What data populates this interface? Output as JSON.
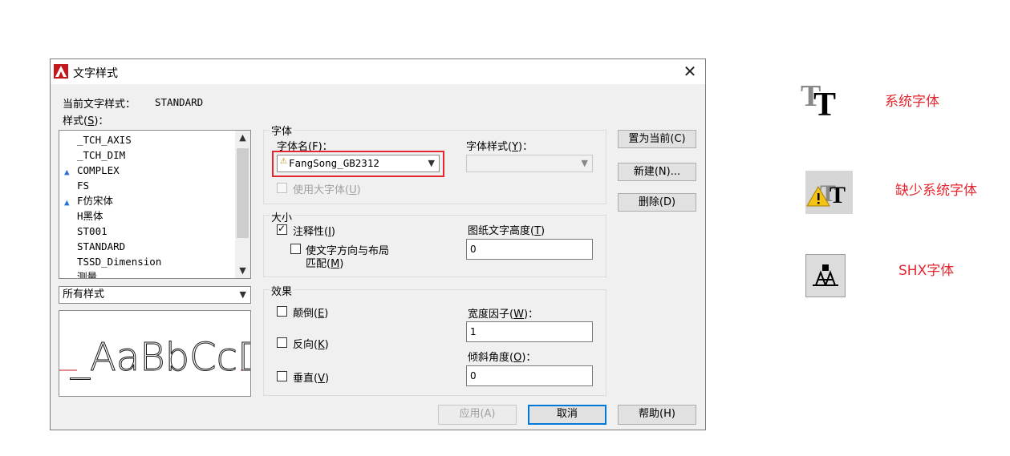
{
  "dialog": {
    "title": "文字样式",
    "current_style_label": "当前文字样式：",
    "current_style_value": "STANDARD",
    "styles_label": "样式(",
    "styles_key": "S",
    "styles_label_end": ")：",
    "styles": [
      "_TCH_AXIS",
      "_TCH_DIM",
      "COMPLEX",
      "FS",
      "F仿宋体",
      "H黑体",
      "ST001",
      "STANDARD",
      "TSSD_Dimension",
      "测量"
    ],
    "filter_value": "所有样式",
    "preview_text": "_AaBbCcD",
    "font_group": {
      "title": "字体",
      "font_name_label": "字体名(",
      "font_name_key": "F",
      "font_name_end": ")：",
      "font_name_value": "FangSong_GB2312",
      "font_style_label": "字体样式(",
      "font_style_key": "Y",
      "font_style_end": ")：",
      "font_style_value": "",
      "bigfont_label": "使用大字体(",
      "bigfont_key": "U",
      "bigfont_end": ")"
    },
    "size_group": {
      "title": "大小",
      "annotative_label": "注释性(",
      "annotative_key": "I",
      "annotative_end": ")",
      "annotative_checked": true,
      "match_label_1": "使文字方向与布局",
      "match_label_2": "匹配(",
      "match_key": "M",
      "match_end": ")",
      "match_checked": false,
      "paper_height_label": "图纸文字高度(",
      "paper_height_key": "T",
      "paper_height_end": ")",
      "paper_height_value": "0"
    },
    "effects_group": {
      "title": "效果",
      "upside_down_label": "颠倒(",
      "upside_down_key": "E",
      "upside_down_end": ")",
      "backwards_label": "反向(",
      "backwards_key": "K",
      "backwards_end": ")",
      "vertical_label": "垂直(",
      "vertical_key": "V",
      "vertical_end": ")",
      "width_factor_label": "宽度因子(",
      "width_factor_key": "W",
      "width_factor_end": ")：",
      "width_factor_value": "1",
      "oblique_label": "倾斜角度(",
      "oblique_key": "O",
      "oblique_end": ")：",
      "oblique_value": "0"
    },
    "buttons": {
      "set_current": "置为当前(C)",
      "new": "新建(N)...",
      "delete": "删除(D)",
      "apply": "应用(A)",
      "cancel": "取消",
      "help": "帮助(H)"
    }
  },
  "legend": {
    "system_font": "系统字体",
    "missing_system_font": "缺少系统字体",
    "shx_font": "SHX字体"
  },
  "colors": {
    "highlight_red": "#e5262f",
    "accent_blue": "#0078d7"
  }
}
